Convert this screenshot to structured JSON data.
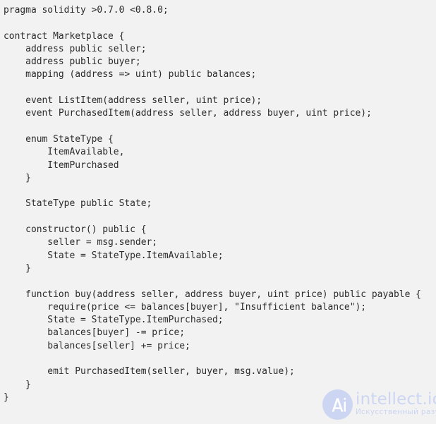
{
  "page": {
    "background_color": "#f2f2f2",
    "text_color": "#2b2b2b",
    "language": "solidity"
  },
  "code": {
    "lines": [
      "pragma solidity >0.7.0 <0.8.0;",
      "",
      "contract Marketplace {",
      "    address public seller;",
      "    address public buyer;",
      "    mapping (address => uint) public balances;",
      "",
      "    event ListItem(address seller, uint price);",
      "    event PurchasedItem(address seller, address buyer, uint price);",
      "",
      "    enum StateType {",
      "        ItemAvailable,",
      "        ItemPurchased",
      "    }",
      "",
      "    StateType public State;",
      "",
      "    constructor() public {",
      "        seller = msg.sender;",
      "        State = StateType.ItemAvailable;",
      "    }",
      "",
      "    function buy(address seller, address buyer, uint price) public payable {",
      "        require(price <= balances[buyer], \"Insufficient balance\");",
      "        State = StateType.ItemPurchased;",
      "        balances[buyer] -= price;",
      "        balances[seller] += price;",
      "",
      "        emit PurchasedItem(seller, buyer, msg.value);",
      "    }",
      "}"
    ]
  },
  "watermark": {
    "logo_text": "Ai",
    "title": "intellect.icu",
    "subtitle": "Искусственный разум",
    "color": "#ccd6f2"
  }
}
